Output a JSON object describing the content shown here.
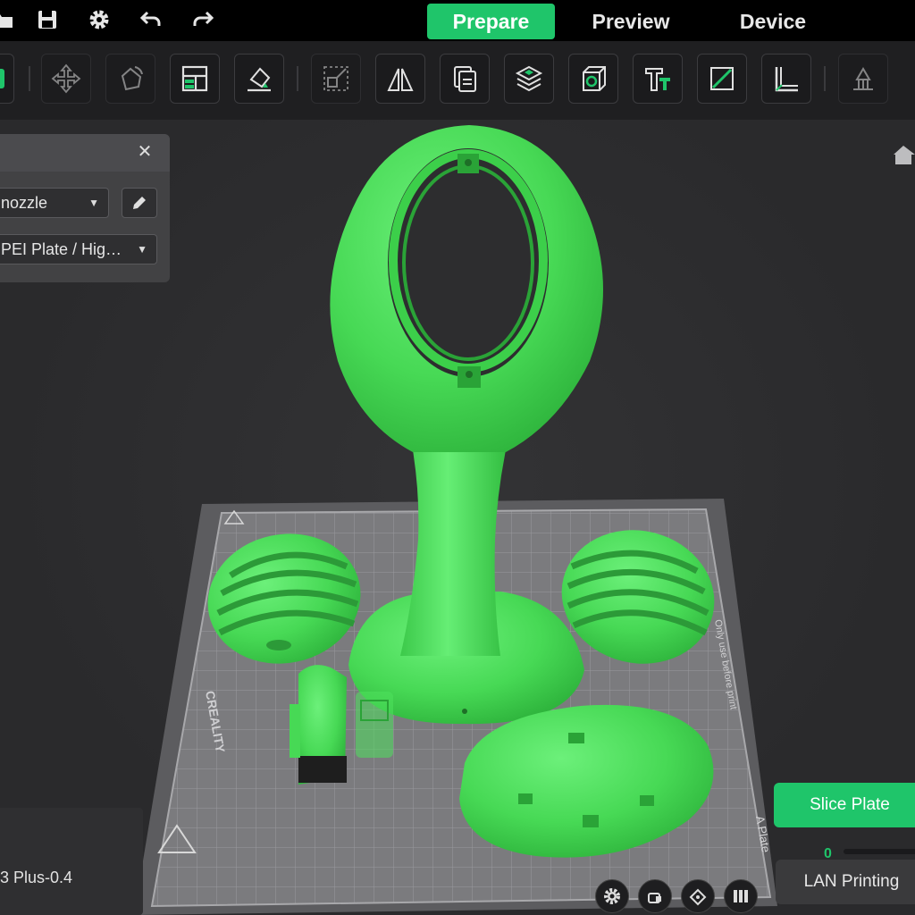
{
  "menubar": {
    "tabs": [
      {
        "label": "Prepare",
        "active": true
      },
      {
        "label": "Preview",
        "active": false
      },
      {
        "label": "Device",
        "active": false
      }
    ],
    "icons": [
      "open-folder-icon",
      "save-icon",
      "settings-gear-icon",
      "undo-icon",
      "redo-icon"
    ]
  },
  "toolbar": {
    "buttons": [
      "add-object-icon",
      "move-icon",
      "rotate-icon",
      "arrange-icon",
      "lay-on-face-icon",
      "scale-icon",
      "mirror-icon",
      "copy-icon",
      "slice-layers-icon",
      "view-cube-icon",
      "text-icon",
      "cut-icon",
      "measure-icon",
      "support-paint-icon"
    ]
  },
  "settings": {
    "nozzle_value": "nozzle",
    "plate_value": "PEI Plate / Hig…"
  },
  "printer": {
    "name": "3 Plus-0.4"
  },
  "actions": {
    "slice_label": "Slice Plate",
    "lan_label": "LAN Printing",
    "progress_value": "0"
  },
  "bed": {
    "brand": "CREALITY",
    "label_right": "A Plate",
    "notice": "Only use before print"
  },
  "colors": {
    "accent": "#1fc56a",
    "model": "#4fe25d",
    "background": "#2c2c2e",
    "bed": "#7d7d80"
  }
}
